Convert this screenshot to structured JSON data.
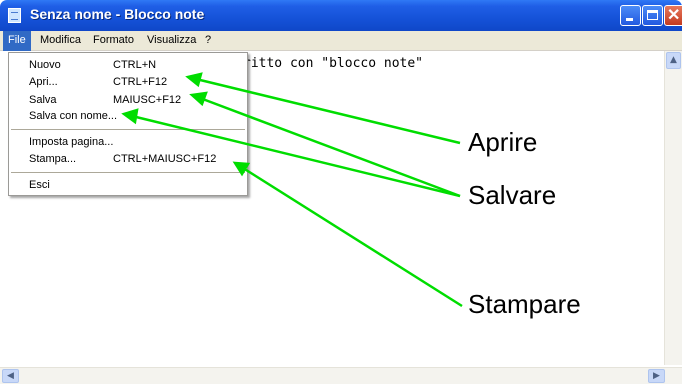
{
  "window": {
    "title": "Senza nome - Blocco note",
    "icon": "notepad-icon"
  },
  "menubar": {
    "items": [
      "File",
      "Modifica",
      "Formato",
      "Visualizza",
      "?"
    ]
  },
  "file_menu": {
    "items": [
      {
        "label": "Nuovo",
        "shortcut": "CTRL+N"
      },
      {
        "label": "Apri...",
        "shortcut": "CTRL+F12"
      },
      {
        "label": "Salva",
        "shortcut": "MAIUSC+F12"
      },
      {
        "label": "Salva con nome...",
        "shortcut": ""
      },
      {
        "label": "Imposta pagina...",
        "shortcut": ""
      },
      {
        "label": "Stampa...",
        "shortcut": "CTRL+MAIUSC+F12"
      },
      {
        "label": "Esci",
        "shortcut": ""
      }
    ]
  },
  "editor": {
    "visible_text": "ritto con \"blocco note\""
  },
  "annotations": {
    "aprire": "Aprire",
    "salvare": "Salvare",
    "stampare": "Stampare",
    "arrow_color": "#00dd00"
  }
}
